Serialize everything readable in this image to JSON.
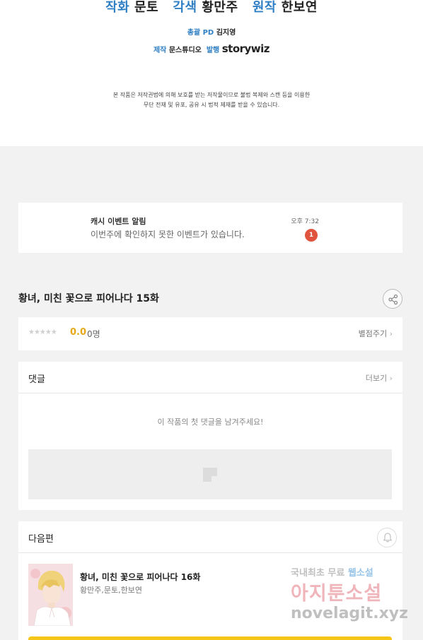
{
  "credits": {
    "art_role": "작화",
    "art_name": "문토",
    "adapt_role": "각색",
    "adapt_name": "황만주",
    "original_role": "원작",
    "original_name": "한보연",
    "pd_role": "총괄 PD",
    "pd_name": "김지영",
    "production_role": "제작",
    "production_name": "문스튜디오",
    "publisher_role": "발행",
    "publisher_name": "storywiz",
    "notice_line1": "본 작품은 저작권법에 의해 보호를 받는 저작물이므로 불법 복제와 스캔 등을 이용한",
    "notice_line2": "무단 전재 및 유포, 공유 시 법적 제재를 받을 수 있습니다."
  },
  "event": {
    "title": "캐시 이벤트 알림",
    "description": "이번주에 확인하지 못한 이벤트가 있습니다.",
    "time": "오후 7:32",
    "badge": "1"
  },
  "episode": {
    "title": "황녀, 미친 꽃으로 피어나다 15화"
  },
  "rating": {
    "stars": "★★★★★",
    "score": "0.0",
    "count": "0명",
    "rate_label": "별점주기"
  },
  "comments": {
    "header": "댓글",
    "more_label": "더보기",
    "empty_message": "이 작품의 첫 댓글을 남겨주세요!"
  },
  "next": {
    "header": "다음편",
    "title": "황녀, 미친 꽃으로 피어나다 16화",
    "authors": "황만주,문토,한보연"
  },
  "watermark": {
    "line1": "국내최초 무료",
    "line1_highlight": "웹소설",
    "line2": "아지툰소설",
    "line3": "novelagit.xyz"
  },
  "colors": {
    "accent_blue": "#2f7fc4",
    "badge_red": "#e0533c",
    "score_yellow": "#e6a817",
    "cta_yellow": "#f5c518"
  }
}
